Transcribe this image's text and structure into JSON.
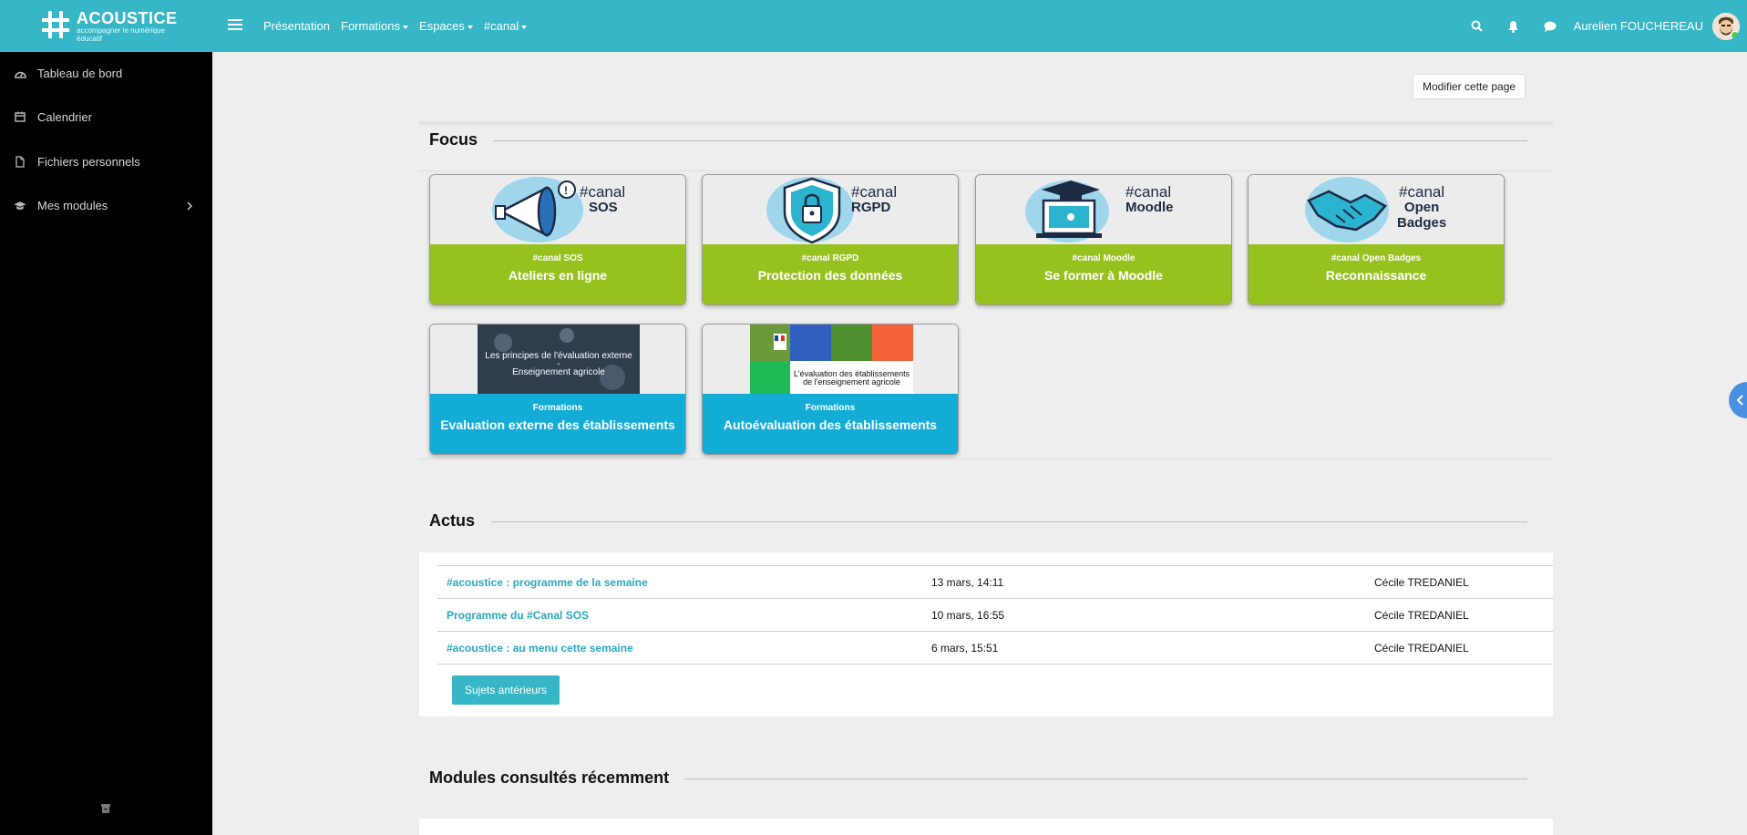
{
  "brand": {
    "name": "ACOUSTICE",
    "tagline": "accompagner le numérique éducatif",
    "color": "#36b6c6"
  },
  "navbar": {
    "menu": [
      {
        "label": "Présentation",
        "dropdown": false
      },
      {
        "label": "Formations",
        "dropdown": true
      },
      {
        "label": "Espaces",
        "dropdown": true
      },
      {
        "label": "#canal",
        "dropdown": true
      }
    ],
    "icons": [
      "search-icon",
      "bell-icon",
      "chat-icon"
    ],
    "user_name": "Aurelien FOUCHEREAU"
  },
  "sidebar": {
    "items": [
      {
        "label": "Tableau de bord",
        "icon": "dashboard-icon"
      },
      {
        "label": "Calendrier",
        "icon": "calendar-icon"
      },
      {
        "label": "Fichiers personnels",
        "icon": "file-icon"
      },
      {
        "label": "Mes modules",
        "icon": "graduation-cap-icon"
      }
    ]
  },
  "page": {
    "edit_button": "Modifier cette page"
  },
  "focus": {
    "title": "Focus",
    "cards": [
      {
        "img_line1": "#canal",
        "img_line2": "SOS",
        "tag": "#canal SOS",
        "title": "Ateliers en ligne",
        "color": "#97c11f"
      },
      {
        "img_line1": "#canal",
        "img_line2": "RGPD",
        "tag": "#canal RGPD",
        "title": "Protection des données",
        "color": "#97c11f"
      },
      {
        "img_line1": "#canal",
        "img_line2": "Moodle",
        "tag": "#canal Moodle",
        "title": "Se former à Moodle",
        "color": "#97c11f"
      },
      {
        "img_line1": "#canal",
        "img_line2": "Open",
        "img_line3": "Badges",
        "tag": "#canal Open Badges",
        "title": "Reconnaissance",
        "color": "#97c11f"
      },
      {
        "img_line1": "Les principes de l'évaluation externe",
        "img_line2": "-",
        "img_line3": "Enseignement agricole",
        "tag": "Formations",
        "title": "Evaluation externe des établissements",
        "color": "#12acd6"
      },
      {
        "img_line1": "L'évaluation des établissements",
        "img_line2": "de l'enseignement agricole",
        "tag": "Formations",
        "title": "Autoévaluation des établissements",
        "color": "#12acd6"
      }
    ]
  },
  "actus": {
    "title": "Actus",
    "rows": [
      {
        "title": "#acoustice : programme de la semaine",
        "date": "13 mars, 14:11",
        "author": "Cécile TREDANIEL"
      },
      {
        "title": "Programme du #Canal SOS",
        "date": "10 mars, 16:55",
        "author": "Cécile TREDANIEL"
      },
      {
        "title": "#acoustice : au menu cette semaine",
        "date": "6 mars, 15:51",
        "author": "Cécile TREDANIEL"
      }
    ],
    "more_button": "Sujets antérieurs"
  },
  "modules": {
    "title": "Modules consultés récemment"
  }
}
